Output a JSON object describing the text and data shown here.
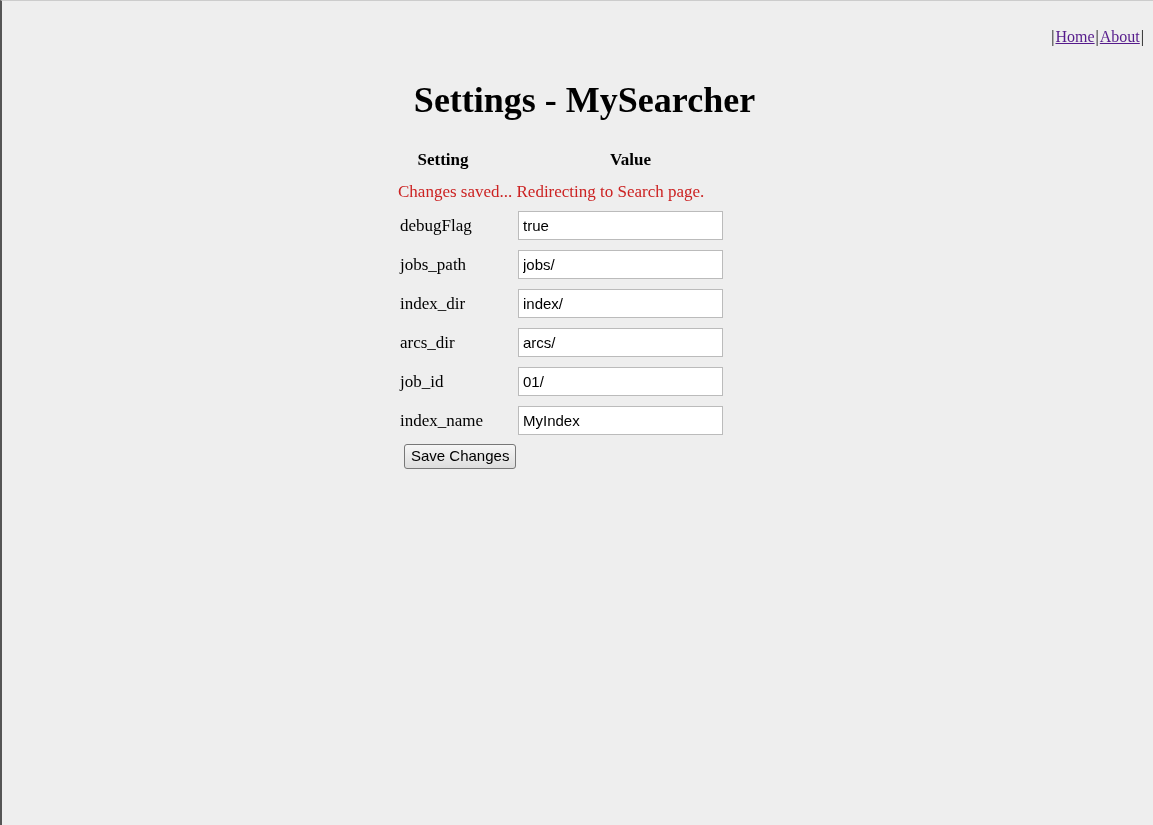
{
  "nav": {
    "separator": "|",
    "links": [
      "Home",
      "About"
    ]
  },
  "title": "Settings - MySearcher",
  "table": {
    "columns": [
      "Setting",
      "Value"
    ],
    "message": "Changes saved... Redirecting to Search page.",
    "rows": [
      {
        "setting": "debugFlag",
        "value": "true"
      },
      {
        "setting": "jobs_path",
        "value": "jobs/"
      },
      {
        "setting": "index_dir",
        "value": "index/"
      },
      {
        "setting": "arcs_dir",
        "value": "arcs/"
      },
      {
        "setting": "job_id",
        "value": "01/"
      },
      {
        "setting": "index_name",
        "value": "MyIndex"
      }
    ]
  },
  "buttons": [
    "Save Changes"
  ]
}
